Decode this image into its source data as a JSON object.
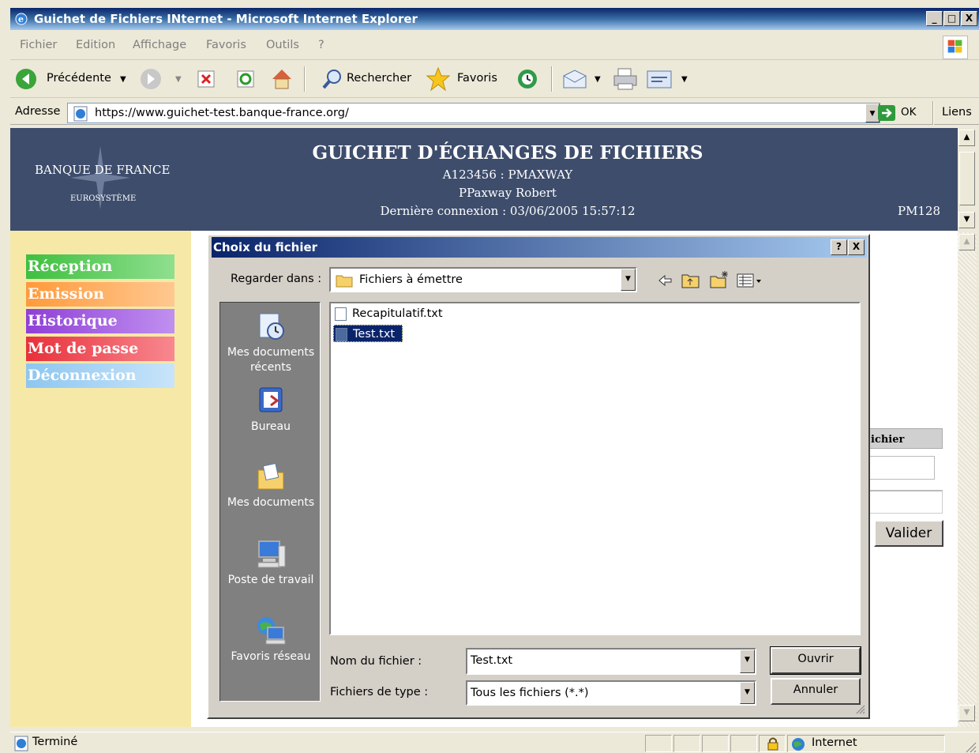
{
  "window": {
    "title": "Guichet de Fichiers INternet - Microsoft Internet Explorer",
    "minimize": "_",
    "maximize": "□",
    "close": "X"
  },
  "menu": [
    "Fichier",
    "Edition",
    "Affichage",
    "Favoris",
    "Outils",
    "?"
  ],
  "toolbar": {
    "back": "Précédente",
    "search": "Rechercher",
    "favorites": "Favoris"
  },
  "address": {
    "label": "Adresse",
    "url": "https://www.guichet-test.banque-france.org/",
    "go": "OK",
    "links": "Liens"
  },
  "banner": {
    "logo_line1": "BANQUE DE FRANCE",
    "logo_line2": "EUROSYSTÈME",
    "title": "GUICHET D'ÉCHANGES DE FICHIERS",
    "account": "A123456 : PMAXWAY",
    "user": "PPaxway Robert",
    "last_login": "Dernière connexion : 03/06/2005 15:57:12",
    "code": "PM128"
  },
  "sidebar": {
    "items": [
      {
        "label": "Réception",
        "color": "#3fbf3f"
      },
      {
        "label": "Emission",
        "color": "#ff9a3c"
      },
      {
        "label": "Historique",
        "color": "#8f3fd6"
      },
      {
        "label": "Mot de passe",
        "color": "#e8303a"
      },
      {
        "label": "Déconnexion",
        "color": "#8ec6f0"
      }
    ]
  },
  "background_form": {
    "column_header": "ichier",
    "submit": "Valider"
  },
  "dialog": {
    "title": "Choix du fichier",
    "help": "?",
    "close": "X",
    "look_in_label": "Regarder dans :",
    "look_in_value": "Fichiers à émettre",
    "places": [
      {
        "label": "Mes documents récents",
        "icon": "recent-documents-icon"
      },
      {
        "label": "Bureau",
        "icon": "desktop-icon"
      },
      {
        "label": "Mes documents",
        "icon": "my-documents-icon"
      },
      {
        "label": "Poste de travail",
        "icon": "my-computer-icon"
      },
      {
        "label": "Favoris réseau",
        "icon": "network-places-icon"
      }
    ],
    "files": [
      {
        "name": "Recapitulatif.txt",
        "selected": false
      },
      {
        "name": "Test.txt",
        "selected": true
      }
    ],
    "filename_label": "Nom du fichier :",
    "filename_value": "Test.txt",
    "filetype_label": "Fichiers de type :",
    "filetype_value": "Tous les fichiers (*.*)",
    "open": "Ouvrir",
    "cancel": "Annuler"
  },
  "status": {
    "text": "Terminé",
    "zone": "Internet"
  }
}
